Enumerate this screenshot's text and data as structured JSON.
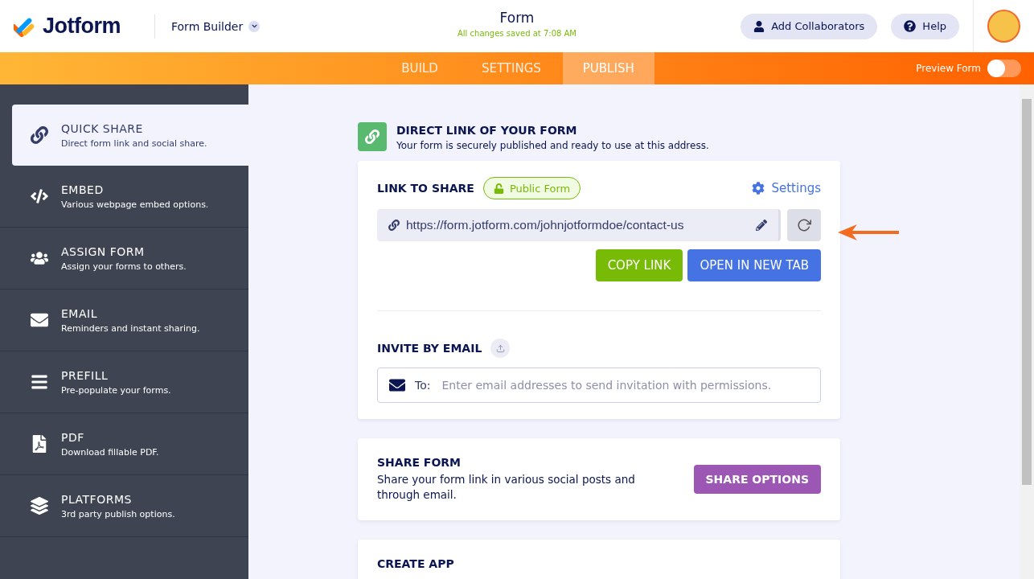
{
  "header": {
    "logo": "Jotform",
    "app_switcher": "Form Builder",
    "title": "Form",
    "save_status": "All changes saved at 7:08 AM",
    "buttons": [
      {
        "kind": "collaborators",
        "label": "Add Collaborators"
      },
      {
        "kind": "help",
        "label": "Help"
      }
    ]
  },
  "nav": {
    "tabs": [
      {
        "label": "BUILD",
        "selected": false
      },
      {
        "label": "SETTINGS",
        "selected": false
      },
      {
        "label": "PUBLISH",
        "selected": true
      }
    ],
    "preview": {
      "label": "Preview Form",
      "on": false
    }
  },
  "sidebar": {
    "items": [
      {
        "kind": "link",
        "title": "QUICK SHARE",
        "subtitle": "Direct form link and social share.",
        "selected": true
      },
      {
        "kind": "code",
        "title": "EMBED",
        "subtitle": "Various webpage embed options.",
        "selected": false
      },
      {
        "kind": "users",
        "title": "ASSIGN FORM",
        "subtitle": "Assign your forms to others.",
        "selected": false
      },
      {
        "kind": "email",
        "title": "EMAIL",
        "subtitle": "Reminders and instant sharing.",
        "selected": false
      },
      {
        "kind": "prefill",
        "title": "PREFILL",
        "subtitle": "Pre-populate your forms.",
        "selected": false
      },
      {
        "kind": "pdf",
        "title": "PDF",
        "subtitle": "Download fillable PDF.",
        "selected": false
      },
      {
        "kind": "layers",
        "title": "PLATFORMS",
        "subtitle": "3rd party publish options.",
        "selected": false
      }
    ]
  },
  "direct_link": {
    "title": "DIRECT LINK OF YOUR FORM",
    "subtitle": "Your form is securely published and ready to use at this address."
  },
  "link_card": {
    "heading": "LINK TO SHARE",
    "badge": "Public Form",
    "settings": "Settings",
    "url": "https://form.jotform.com/johnjotformdoe/contact-us",
    "buttons": [
      {
        "kind": "copy",
        "label": "COPY LINK"
      },
      {
        "kind": "open",
        "label": "OPEN IN NEW TAB"
      }
    ],
    "invite": {
      "heading": "INVITE BY EMAIL",
      "to_label": "To:",
      "placeholder": "Enter email addresses to send invitation with permissions."
    }
  },
  "share_form": {
    "title": "SHARE FORM",
    "text": "Share your form link in various social posts and through email.",
    "button": "SHARE OPTIONS"
  },
  "create_app": {
    "title": "CREATE APP"
  }
}
